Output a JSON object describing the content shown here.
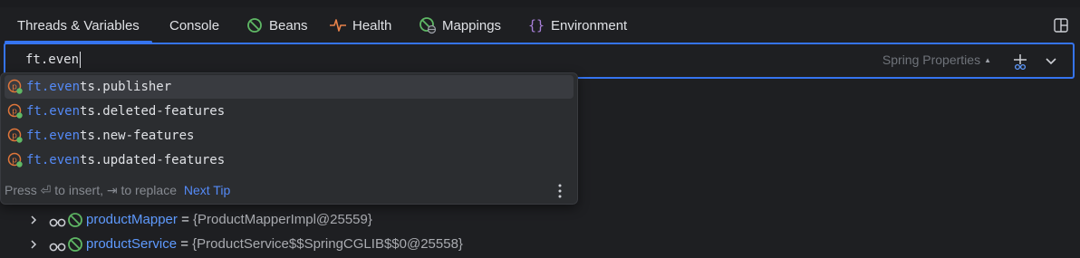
{
  "tabs": [
    {
      "label": "Threads & Variables",
      "icon": "none",
      "active": true
    },
    {
      "label": "Console",
      "icon": "none",
      "active": false
    },
    {
      "label": "Beans",
      "icon": "bean-icon",
      "active": false
    },
    {
      "label": "Health",
      "icon": "pulse-icon",
      "active": false
    },
    {
      "label": "Mappings",
      "icon": "mappings-icon",
      "active": false
    },
    {
      "label": "Environment",
      "icon": "braces-icon",
      "active": false
    }
  ],
  "expression": {
    "value": "ft.even",
    "language": "Spring Properties"
  },
  "completion": {
    "match_prefix": "ft.even",
    "items": [
      {
        "match": "ft.even",
        "rest": "ts.publisher",
        "selected": true
      },
      {
        "match": "ft.even",
        "rest": "ts.deleted-features",
        "selected": false
      },
      {
        "match": "ft.even",
        "rest": "ts.new-features",
        "selected": false
      },
      {
        "match": "ft.even",
        "rest": "ts.updated-features",
        "selected": false
      }
    ],
    "footer": {
      "hint": "Press ⏎ to insert, ⇥ to replace",
      "tip_link": "Next Tip"
    }
  },
  "tree": [
    {
      "name": "productMapper",
      "eq": " = ",
      "value": "{ProductMapperImpl@25559}"
    },
    {
      "name": "productService",
      "eq": " = ",
      "value": "{ProductService$$SpringCGLIB$$0@25558}"
    }
  ],
  "colors": {
    "accent": "#3574f0",
    "match": "#548af7",
    "bean_green": "#5fb865",
    "property_orange": "#e0763a",
    "health_orange": "#e8824a",
    "env_purple": "#a87fd8"
  }
}
